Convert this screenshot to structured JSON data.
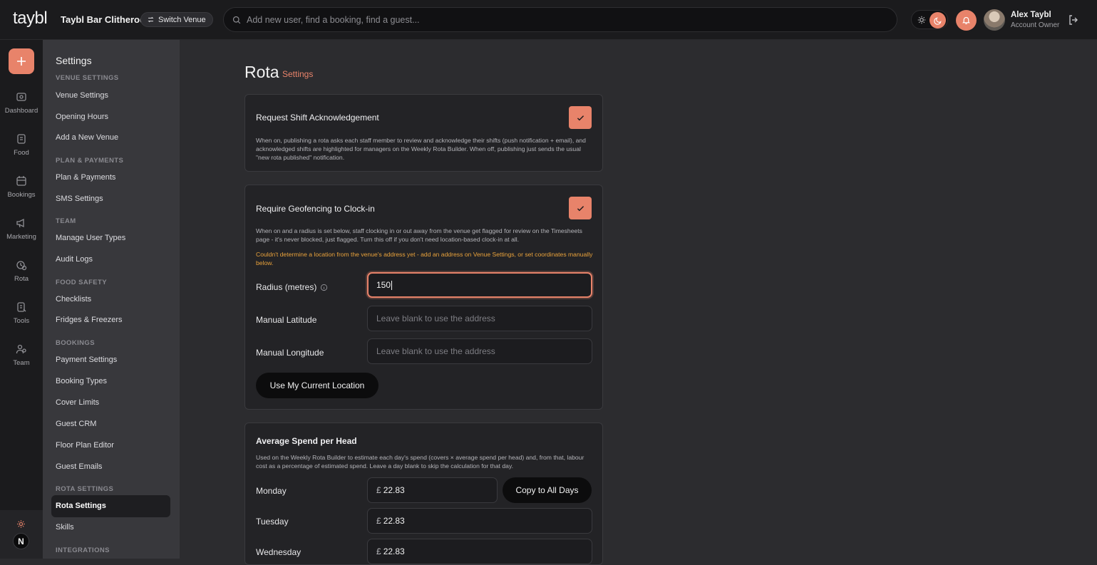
{
  "topbar": {
    "logo": "taybl",
    "venue_name": "Taybl Bar Clitheroe",
    "switch_venue": "Switch Venue",
    "search_placeholder": "Add new user, find a booking, find a guest...",
    "user_name": "Alex Taybl",
    "user_role": "Account Owner"
  },
  "rail": {
    "items": [
      {
        "label": "Dashboard",
        "icon": "dashboard-icon"
      },
      {
        "label": "Food",
        "icon": "food-icon"
      },
      {
        "label": "Bookings",
        "icon": "bookings-icon"
      },
      {
        "label": "Marketing",
        "icon": "megaphone-icon"
      },
      {
        "label": "Rota",
        "icon": "rota-icon"
      },
      {
        "label": "Tools",
        "icon": "tools-icon"
      },
      {
        "label": "Team",
        "icon": "team-icon"
      }
    ],
    "bottom_initial": "N"
  },
  "sidebar": {
    "title": "Settings",
    "sections": [
      {
        "heading": "VENUE SETTINGS",
        "items": [
          "Venue Settings",
          "Opening Hours",
          "Add a New Venue"
        ]
      },
      {
        "heading": "PLAN & PAYMENTS",
        "items": [
          "Plan & Payments",
          "SMS Settings"
        ]
      },
      {
        "heading": "TEAM",
        "items": [
          "Manage User Types",
          "Audit Logs"
        ]
      },
      {
        "heading": "FOOD SAFETY",
        "items": [
          "Checklists",
          "Fridges & Freezers"
        ]
      },
      {
        "heading": "BOOKINGS",
        "items": [
          "Payment Settings",
          "Booking Types",
          "Cover Limits",
          "Guest CRM",
          "Floor Plan Editor",
          "Guest Emails"
        ]
      },
      {
        "heading": "ROTA SETTINGS",
        "items": [
          "Rota Settings",
          "Skills"
        ]
      },
      {
        "heading": "INTEGRATIONS",
        "items": []
      }
    ],
    "active_item": "Rota Settings"
  },
  "main": {
    "title": "Rota",
    "subtitle": "Settings",
    "acknowledgement": {
      "label": "Request Shift Acknowledgement",
      "checked": true,
      "description": "When on, publishing a rota asks each staff member to review and acknowledge their shifts (push notification + email), and acknowledged shifts are highlighted for managers on the Weekly Rota Builder. When off, publishing just sends the usual \"new rota published\" notification."
    },
    "geofencing": {
      "label": "Require Geofencing to Clock-in",
      "checked": true,
      "description": "When on and a radius is set below, staff clocking in or out away from the venue get flagged for review on the Timesheets page - it's never blocked, just flagged. Turn this off if you don't need location-based clock-in at all.",
      "warning": "Couldn't determine a location from the venue's address yet - add an address on Venue Settings, or set coordinates manually below.",
      "radius_label": "Radius (metres)",
      "radius_value": "150",
      "latitude_label": "Manual Latitude",
      "latitude_placeholder": "Leave blank to use the address",
      "longitude_label": "Manual Longitude",
      "longitude_placeholder": "Leave blank to use the address",
      "location_button": "Use My Current Location"
    },
    "spend": {
      "label": "Average Spend per Head",
      "description": "Used on the Weekly Rota Builder to estimate each day's spend (covers × average spend per head) and, from that, labour cost as a percentage of estimated spend. Leave a day blank to skip the calculation for that day.",
      "currency": "£",
      "copy_button": "Copy to All Days",
      "days": [
        {
          "day": "Monday",
          "value": "22.83"
        },
        {
          "day": "Tuesday",
          "value": "22.83"
        },
        {
          "day": "Wednesday",
          "value": "22.83"
        }
      ]
    }
  },
  "colors": {
    "accent": "#e8836a",
    "warning": "#e9a23b",
    "background": "#2c2c2f"
  }
}
